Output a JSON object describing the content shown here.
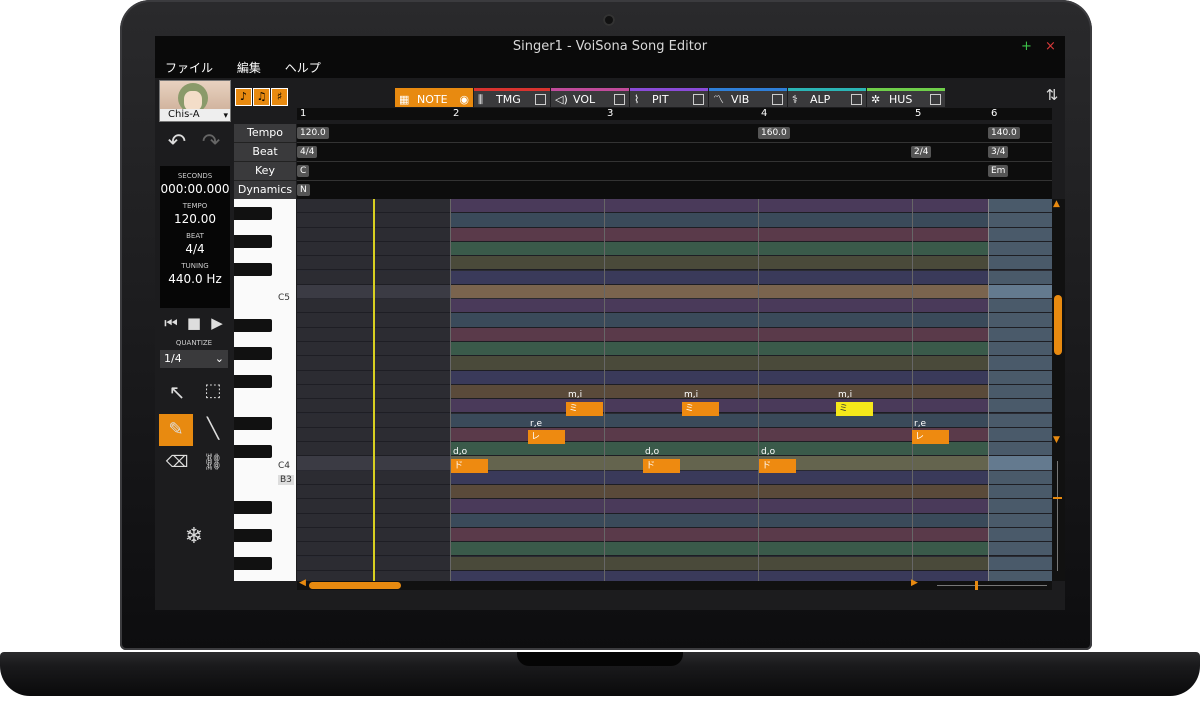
{
  "window": {
    "title": "Singer1 - VoiSona Song Editor",
    "plus": "+",
    "close": "×"
  },
  "menu": {
    "items": [
      "ファイル",
      "編集",
      "ヘルプ"
    ]
  },
  "singer": {
    "name": "Chis-A"
  },
  "readout": {
    "seconds_label": "SECONDS",
    "seconds": "000:00.000",
    "tempo_label": "TEMPO",
    "tempo": "120.00",
    "beat_label": "BEAT",
    "beat": "4/4",
    "tuning_label": "TUNING",
    "tuning": "440.0 Hz"
  },
  "quantize": {
    "label": "QUANTIZE",
    "value": "1/4"
  },
  "tabs": [
    {
      "name": "NOTE",
      "accent": "#e88a10"
    },
    {
      "name": "TMG",
      "accent": "#d8332f"
    },
    {
      "name": "VOL",
      "accent": "#c14b9b"
    },
    {
      "name": "PIT",
      "accent": "#8a4bd8"
    },
    {
      "name": "VIB",
      "accent": "#2f7fd8"
    },
    {
      "name": "ALP",
      "accent": "#2bb5b5"
    },
    {
      "name": "HUS",
      "accent": "#6fcf4a"
    }
  ],
  "measures": [
    "1",
    "2",
    "3",
    "4",
    "5",
    "6"
  ],
  "tracks": {
    "tempo_label": "Tempo",
    "beat_label": "Beat",
    "key_label": "Key",
    "dynamics_label": "Dynamics",
    "tempo_values": [
      "120.0",
      "160.0",
      "140.0"
    ],
    "beat_values": [
      "4/4",
      "2/4",
      "3/4"
    ],
    "key_values": [
      "C",
      "Em"
    ],
    "dynamics_values": [
      "N"
    ]
  },
  "piano_labels": {
    "c5": "C5",
    "c4": "C4",
    "b3": "B3"
  },
  "notes": [
    {
      "lyric": "ド",
      "phoneme": "d,o"
    },
    {
      "lyric": "レ",
      "phoneme": "r,e"
    },
    {
      "lyric": "ミ",
      "phoneme": "m,i"
    },
    {
      "lyric": "ド",
      "phoneme": "d,o"
    },
    {
      "lyric": "ミ",
      "phoneme": "m,i"
    },
    {
      "lyric": "ド",
      "phoneme": "d,o"
    },
    {
      "lyric": "ミ",
      "phoneme": "m,i"
    },
    {
      "lyric": "レ",
      "phoneme": "r,e"
    }
  ],
  "colors": {
    "accent": "#e88a10",
    "selected_note": "#f5e81a",
    "playhead": "#d8d020"
  }
}
